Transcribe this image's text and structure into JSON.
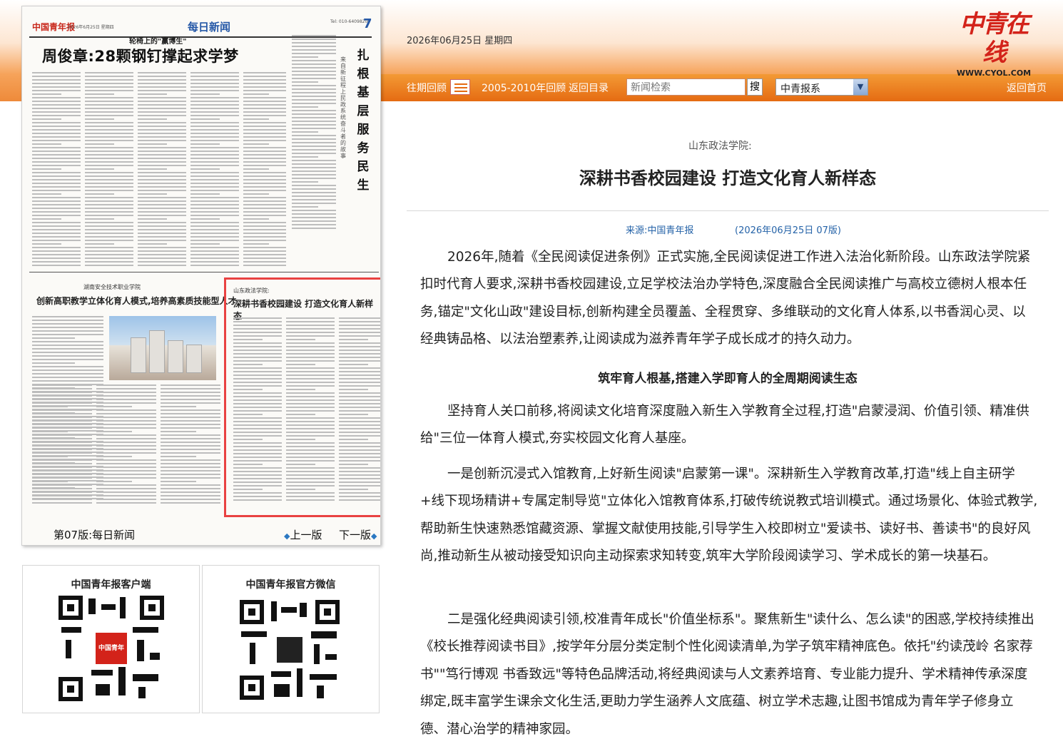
{
  "header": {
    "date": "2026年06月25日 星期四",
    "logo_text": "中青在线",
    "logo_url": "WWW.CYOL.COM"
  },
  "nav": {
    "past_review": "往期回顾",
    "archive": "2005-2010年回顾",
    "back_to_index": "返回目录",
    "search_placeholder": "新闻检索",
    "search_button": "搜",
    "select_value": "中青报系",
    "home": "返回首页"
  },
  "paper": {
    "brand": "中国青年报",
    "small_date": "2026年6月25日 星期四",
    "section": "每日新闻",
    "tel": "Tel: 010-64098200",
    "page_number": "7",
    "kicker": "轮椅上的\"赢博生\"",
    "headline": "周俊章:28颗钢钉撑起求学梦",
    "vertical_title": "扎根基层服务民生",
    "vertical_sub": "来自新征程上民政系统奋斗者的故事",
    "box1_kicker": "湖南安全技术职业学院",
    "box1_title": "创新高职教学立体化育人模式,培养高素质技能型人才",
    "box2_kicker": "山东政法学院:",
    "box2_title": "深耕书香校园建设 打造文化育人新样态",
    "footer_label": "第07版:每日新闻",
    "prev": "上一版",
    "next": "下一版"
  },
  "qr": {
    "client_title": "中国青年报客户端",
    "wechat_title": "中国青年报官方微信"
  },
  "article": {
    "kicker": "山东政法学院:",
    "title": "深耕书香校园建设 打造文化育人新样态",
    "source": "来源:中国青年报",
    "date": "(2026年06月25日 07版)",
    "p1": "2026年,随着《全民阅读促进条例》正式实施,全民阅读促进工作进入法治化新阶段。山东政法学院紧扣时代育人要求,深耕书香校园建设,立足学校法治办学特色,深度融合全民阅读推广与高校立德树人根本任务,锚定\"文化山政\"建设目标,创新构建全员覆盖、全程贯穿、多维联动的文化育人体系,以书香润心灵、以经典铸品格、以法治塑素养,让阅读成为滋养青年学子成长成才的持久动力。",
    "subhead": "筑牢育人根基,搭建入学即育人的全周期阅读生态",
    "p2": "坚持育人关口前移,将阅读文化培育深度融入新生入学教育全过程,打造\"启蒙浸润、价值引领、精准供给\"三位一体育人模式,夯实校园文化育人基座。",
    "p3": "一是创新沉浸式入馆教育,上好新生阅读\"启蒙第一课\"。深耕新生入学教育改革,打造\"线上自主研学+线下现场精讲+专属定制导览\"立体化入馆教育体系,打破传统说教式培训模式。通过场景化、体验式教学,帮助新生快速熟悉馆藏资源、掌握文献使用技能,引导学生入校即树立\"爱读书、读好书、善读书\"的良好风尚,推动新生从被动接受知识向主动探索求知转变,筑牢大学阶段阅读学习、学术成长的第一块基石。",
    "p4": "二是强化经典阅读引领,校准青年成长\"价值坐标系\"。聚焦新生\"读什么、怎么读\"的困惑,学校持续推出《校长推荐阅读书目》,按学年分层分类定制个性化阅读清单,为学子筑牢精神底色。依托\"约读茂岭 名家荐书\"\"笃行博观 书香致远\"等特色品牌活动,将经典阅读与人文素养培育、专业能力提升、学术精神传承深度绑定,既丰富学生课余文化生活,更助力学生涵养人文底蕴、树立学术志趣,让图书馆成为青年学子修身立德、潜心治学的精神家园。"
  }
}
